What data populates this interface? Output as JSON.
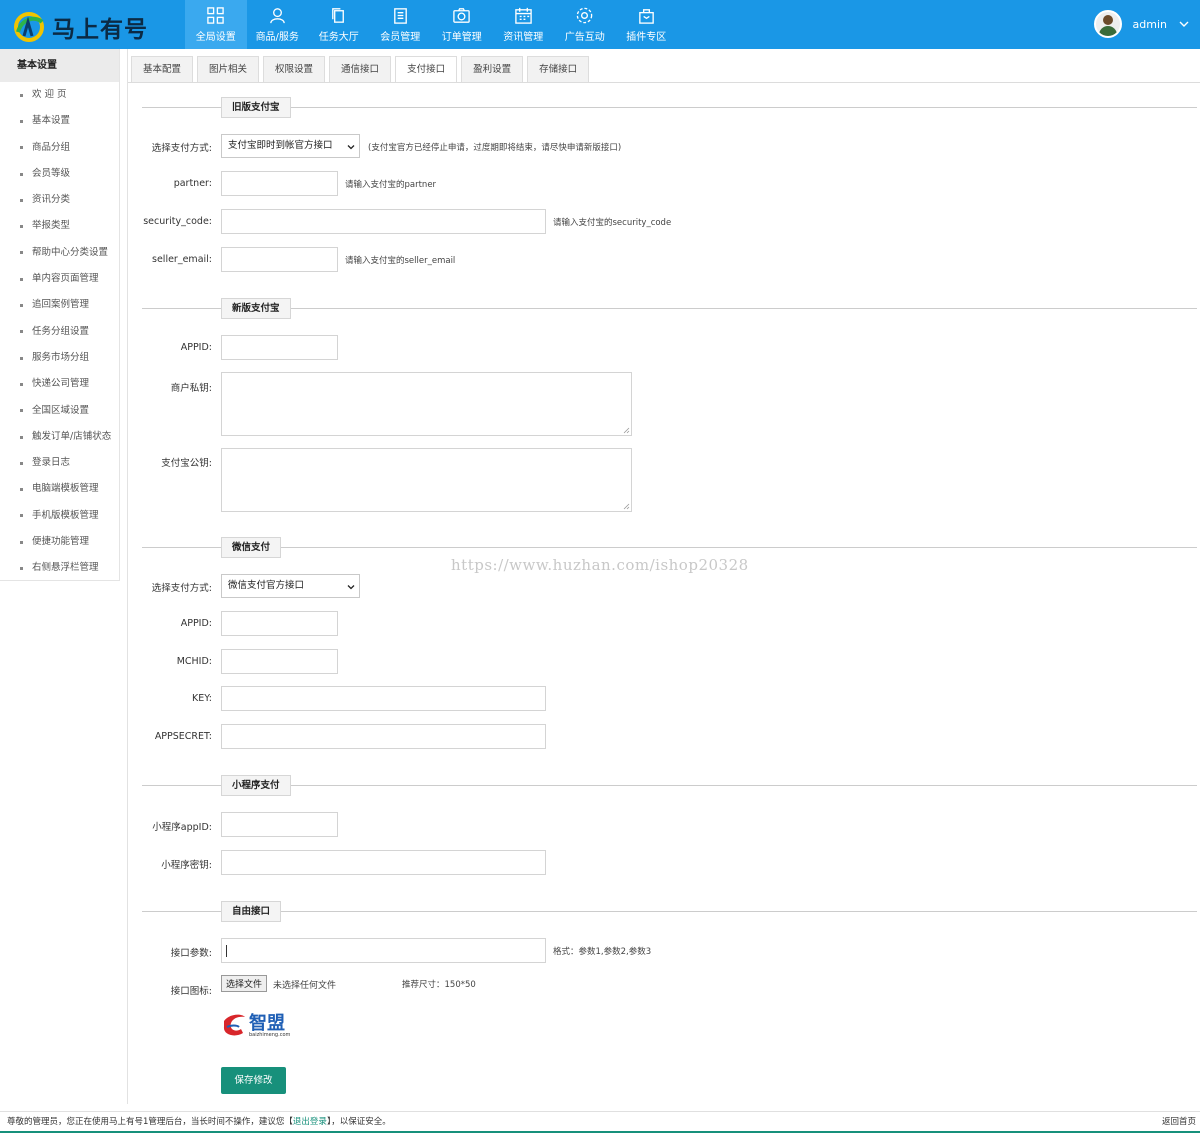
{
  "app": {
    "brand": "马上有号",
    "user_name": "admin"
  },
  "nav": [
    {
      "label": "全局设置",
      "icon": "grid-icon",
      "active": true
    },
    {
      "label": "商品/服务",
      "icon": "user-icon"
    },
    {
      "label": "任务大厅",
      "icon": "copy-icon"
    },
    {
      "label": "会员管理",
      "icon": "list-icon"
    },
    {
      "label": "订单管理",
      "icon": "camera-icon"
    },
    {
      "label": "资讯管理",
      "icon": "calendar-icon"
    },
    {
      "label": "广告互动",
      "icon": "gear-icon"
    },
    {
      "label": "插件专区",
      "icon": "bag-icon"
    }
  ],
  "sidebar": {
    "title": "基本设置",
    "items": [
      "欢 迎 页",
      "基本设置",
      "商品分组",
      "会员等级",
      "资讯分类",
      "举报类型",
      "帮助中心分类设置",
      "单内容页面管理",
      "追回案例管理",
      "任务分组设置",
      "服务市场分组",
      "快递公司管理",
      "全国区域设置",
      "触发订单/店铺状态",
      "登录日志",
      "电脑端模板管理",
      "手机版模板管理",
      "便捷功能管理",
      "右侧悬浮栏管理"
    ]
  },
  "tabs": [
    "基本配置",
    "图片相关",
    "权限设置",
    "通信接口",
    "支付接口",
    "盈利设置",
    "存储接口"
  ],
  "active_tab": "支付接口",
  "sections": {
    "old_alipay": {
      "title": "旧版支付宝",
      "pay_method_label": "选择支付方式:",
      "pay_method_value": "支付宝即时到帐官方接口",
      "pay_method_note": "(支付宝官方已经停止申请，过度期即将结束，请尽快申请新版接口)",
      "partner_label": "partner:",
      "partner_hint": "请输入支付宝的partner",
      "security_label": "security_code:",
      "security_hint": "请输入支付宝的security_code",
      "seller_label": "seller_email:",
      "seller_hint": "请输入支付宝的seller_email"
    },
    "new_alipay": {
      "title": "新版支付宝",
      "appid_label": "APPID:",
      "private_key_label": "商户私钥:",
      "public_key_label": "支付宝公钥:"
    },
    "wechat": {
      "title": "微信支付",
      "pay_method_label": "选择支付方式:",
      "pay_method_value": "微信支付官方接口",
      "appid_label": "APPID:",
      "mchid_label": "MCHID:",
      "key_label": "KEY:",
      "appsecret_label": "APPSECRET:"
    },
    "miniprogram": {
      "title": "小程序支付",
      "appid_label": "小程序appID:",
      "secret_label": "小程序密钥:"
    },
    "custom": {
      "title": "自由接口",
      "params_label": "接口参数:",
      "params_hint": "格式：参数1,参数2,参数3",
      "icon_label": "接口图标:",
      "file_button": "选择文件",
      "file_status": "未选择任何文件",
      "size_hint": "推荐尺寸：150*50",
      "logo_text": "智盟",
      "logo_sub": "baizhimeng.com"
    }
  },
  "save_label": "保存修改",
  "watermark": "https://www.huzhan.com/ishop20328",
  "footer": {
    "text_before": "尊敬的管理员，您正在使用马上有号1管理后台，当长时间不操作，建议您【",
    "logout_link": "退出登录",
    "text_after": "】，以保证安全。",
    "right": "返回首页"
  },
  "colors": {
    "topbar": "#1a97e6",
    "accent": "#17907b"
  }
}
